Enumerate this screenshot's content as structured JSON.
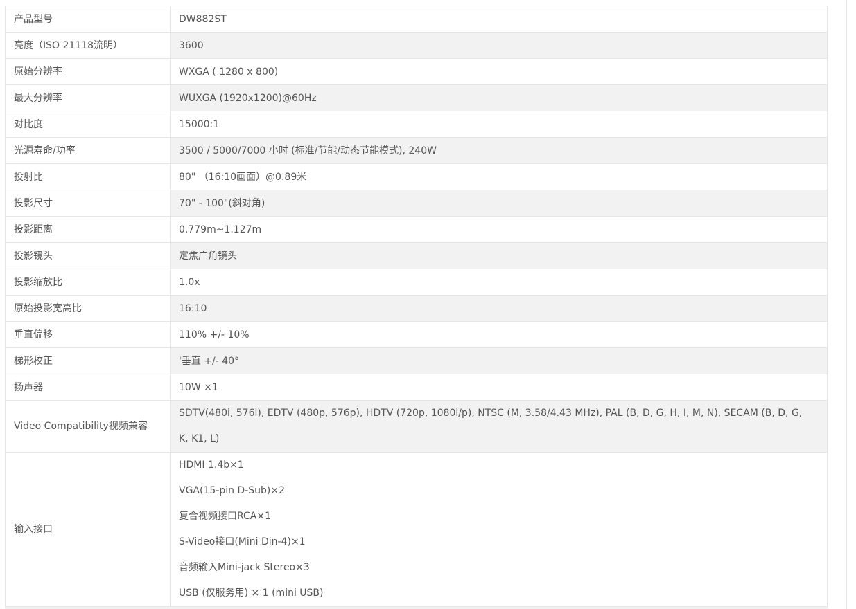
{
  "specs": [
    {
      "label": "产品型号",
      "value": "DW882ST"
    },
    {
      "label": "亮度（ISO 21118流明）",
      "value": "3600"
    },
    {
      "label": "原始分辨率",
      "value": "WXGA ( 1280 x 800)"
    },
    {
      "label": "最大分辨率",
      "value": "WUXGA (1920x1200)@60Hz"
    },
    {
      "label": "对比度",
      "value": "15000:1"
    },
    {
      "label": "光源寿命/功率",
      "value": "3500 / 5000/7000 小时 (标准/节能/动态节能模式), 240W"
    },
    {
      "label": "投射比",
      "value": "80\" （16:10画面）@0.89米"
    },
    {
      "label": "投影尺寸",
      "value": "70\" - 100\"(斜对角)"
    },
    {
      "label": "投影距离",
      "value": "0.779m~1.127m"
    },
    {
      "label": "投影镜头",
      "value": "定焦广角镜头"
    },
    {
      "label": "投影缩放比",
      "value": "1.0x"
    },
    {
      "label": "原始投影宽高比",
      "value": "16:10"
    },
    {
      "label": "垂直偏移",
      "value": "110% +/- 10%"
    },
    {
      "label": "梯形校正",
      "value": "'垂直 +/- 40°"
    },
    {
      "label": "扬声器",
      "value": "10W ×1"
    },
    {
      "label": "Video Compatibility视频兼容",
      "value_line1": "SDTV(480i, 576i), EDTV (480p, 576p), HDTV (720p, 1080i/p), NTSC (M, 3.58/4.43 MHz), PAL (B, D, G, H, I, M, N), SECAM (B, D, G,",
      "value_line2": "K, K1, L)"
    },
    {
      "label": "输入接口",
      "lines": [
        "HDMI 1.4b×1",
        "VGA(15-pin D-Sub)×2",
        "复合视频接口RCA×1",
        "S-Video接口(Mini Din-4)×1",
        "音频输入Mini-jack Stereo×3",
        "USB (仅服务用) × 1 (mini USB)"
      ]
    }
  ]
}
